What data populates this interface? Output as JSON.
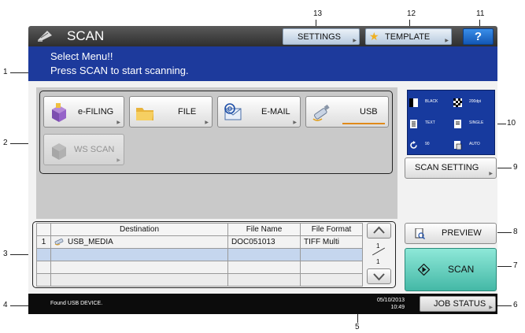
{
  "title_bar": {
    "title": "SCAN",
    "settings_label": "SETTINGS",
    "template_label": "TEMPLATE",
    "help_label": "?"
  },
  "message": {
    "line1": "Select Menu!!",
    "line2": "Press SCAN to start scanning."
  },
  "functions": {
    "efiling": "e-FILING",
    "file": "FILE",
    "email": "E-MAIL",
    "usb": "USB",
    "wsscan": "WS SCAN"
  },
  "settings_preview": {
    "color_mode": "BLACK",
    "resolution": "200dpi",
    "original_mode": "TEXT",
    "duplex": "SINGLE",
    "rotation": "90",
    "size": "AUTO"
  },
  "scan_setting_label": "SCAN SETTING",
  "destination_table": {
    "headers": [
      "",
      "Destination",
      "File Name",
      "File Format"
    ],
    "rows": [
      {
        "num": "1",
        "destination": "USB_MEDIA",
        "file_name": "DOC051013",
        "file_format": "TIFF Multi"
      }
    ]
  },
  "pagination": {
    "current": "1",
    "total": "1"
  },
  "actions": {
    "preview_label": "PREVIEW",
    "scan_label": "SCAN"
  },
  "status_bar": {
    "message": "Found USB DEVICE.",
    "date": "05/10/2013",
    "time": "10:49",
    "job_status_label": "JOB STATUS"
  },
  "callouts": {
    "n1": "1",
    "n2": "2",
    "n3": "3",
    "n4": "4",
    "n5": "5",
    "n6": "6",
    "n7": "7",
    "n8": "8",
    "n9": "9",
    "n10": "10",
    "n11": "11",
    "n12": "12",
    "n13": "13"
  },
  "colors": {
    "message_bar": "#1d3a9c",
    "help_button": "#1f6fd6",
    "scan_button": "#5ccab8",
    "selected_row": "#c5d6ee",
    "usb_selected_accent": "#e08a1a"
  }
}
